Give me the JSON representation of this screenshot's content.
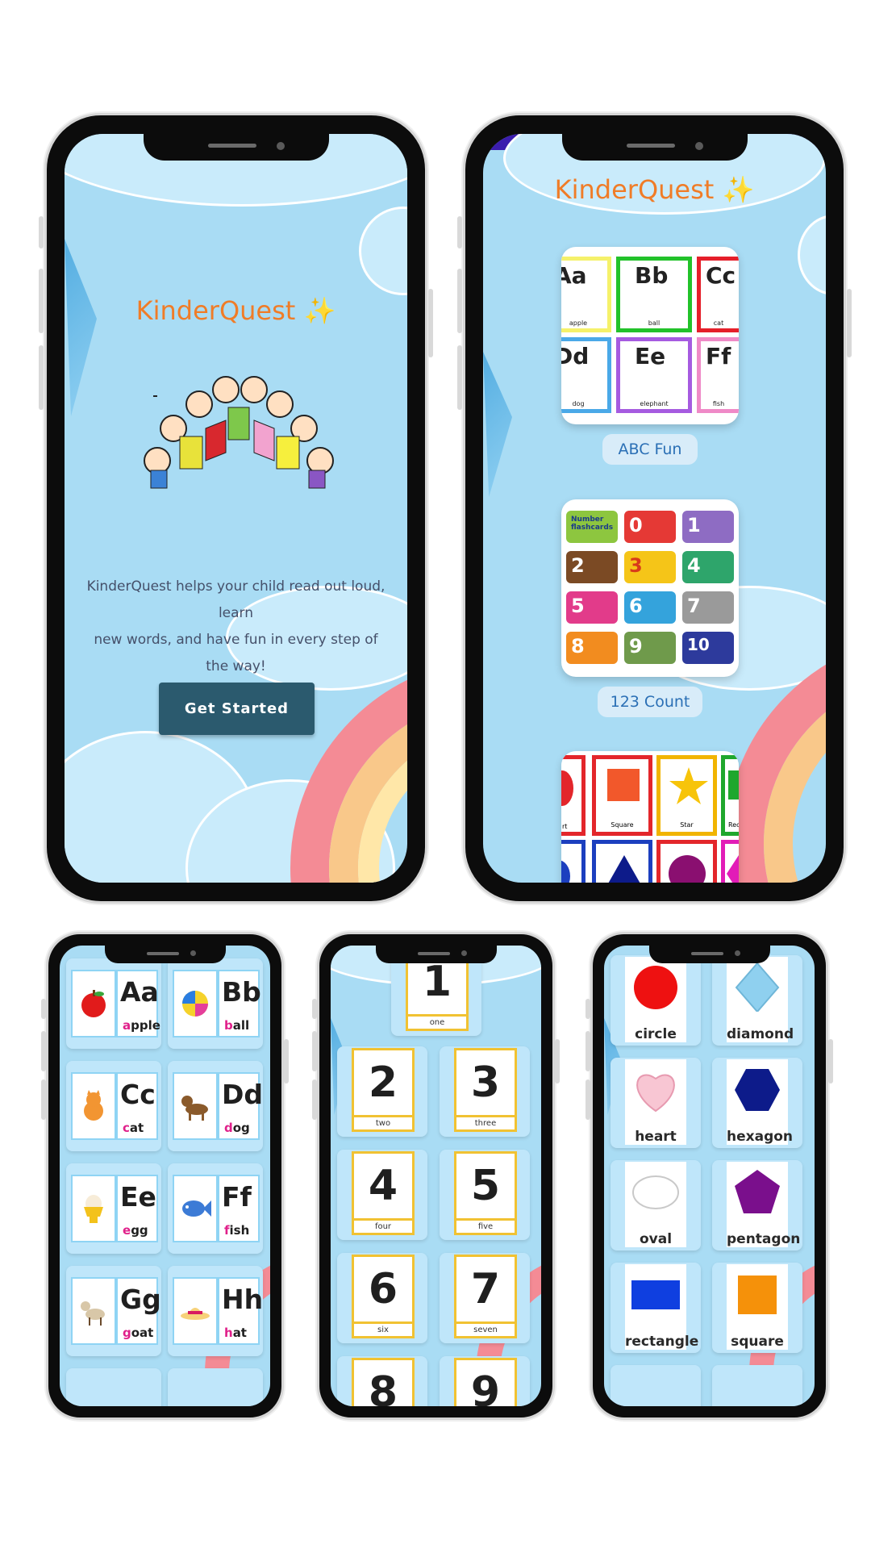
{
  "app": {
    "name": "KinderQuest",
    "sparkle": "✨"
  },
  "welcome": {
    "description_line1": "KinderQuest helps your child read out loud, learn",
    "description_line2": "new words, and have fun in every step of the way!",
    "button_label": "Get Started"
  },
  "menu": {
    "categories": [
      {
        "label": "ABC Fun"
      },
      {
        "label": "123 Count"
      }
    ],
    "abc_preview": [
      {
        "letters": "Aa",
        "word": "apple",
        "color": "#f5f16a"
      },
      {
        "letters": "Bb",
        "word": "ball",
        "color": "#22c22a"
      },
      {
        "letters": "Cc",
        "word": "cat",
        "color": "#e51f2a"
      },
      {
        "letters": "Dd",
        "word": "dog",
        "color": "#4aa9e8"
      },
      {
        "letters": "Ee",
        "word": "elephant",
        "color": "#a65be0"
      },
      {
        "letters": "Ff",
        "word": "fish",
        "color": "#ef8ac7"
      }
    ],
    "number_preview": [
      {
        "label": "Number flashcards",
        "color": "#8dc63f"
      },
      {
        "label": "0",
        "color": "#e53935"
      },
      {
        "label": "1",
        "color": "#8e6cc3"
      },
      {
        "label": "2",
        "color": "#7b4a24"
      },
      {
        "label": "3",
        "color": "#f5c518"
      },
      {
        "label": "4",
        "color": "#2ea56b"
      },
      {
        "label": "5",
        "color": "#e23b8a"
      },
      {
        "label": "6",
        "color": "#34a3dc"
      },
      {
        "label": "7",
        "color": "#9a9a9a"
      },
      {
        "label": "8",
        "color": "#f28c1f"
      },
      {
        "label": "9",
        "color": "#6f9a4b"
      },
      {
        "label": "10",
        "color": "#2d3a9c"
      }
    ],
    "shapes_preview": [
      {
        "word": "rt"
      },
      {
        "word": "Square"
      },
      {
        "word": "Star"
      },
      {
        "word": "Rect"
      }
    ]
  },
  "alphabet": [
    {
      "letters": "Aa",
      "prefix": "a",
      "rest": "pple",
      "icon": "apple-icon"
    },
    {
      "letters": "Bb",
      "prefix": "b",
      "rest": "all",
      "icon": "ball-icon"
    },
    {
      "letters": "Cc",
      "prefix": "c",
      "rest": "at",
      "icon": "cat-icon"
    },
    {
      "letters": "Dd",
      "prefix": "d",
      "rest": "og",
      "icon": "dog-icon"
    },
    {
      "letters": "Ee",
      "prefix": "e",
      "rest": "gg",
      "icon": "egg-icon"
    },
    {
      "letters": "Ff",
      "prefix": "f",
      "rest": "ish",
      "icon": "fish-icon"
    },
    {
      "letters": "Gg",
      "prefix": "g",
      "rest": "oat",
      "icon": "goat-icon"
    },
    {
      "letters": "Hh",
      "prefix": "h",
      "rest": "at",
      "icon": "hat-icon"
    }
  ],
  "numbers": [
    {
      "n": "1",
      "word": "one"
    },
    {
      "n": "2",
      "word": "two"
    },
    {
      "n": "3",
      "word": "three"
    },
    {
      "n": "4",
      "word": "four"
    },
    {
      "n": "5",
      "word": "five"
    },
    {
      "n": "6",
      "word": "six"
    },
    {
      "n": "7",
      "word": "seven"
    },
    {
      "n": "8",
      "word": ""
    },
    {
      "n": "9",
      "word": ""
    }
  ],
  "shapes": [
    {
      "word": "circle",
      "color": "#ee1111",
      "icon": "circle-icon"
    },
    {
      "word": "diamond",
      "color": "#8fd0ef",
      "icon": "diamond-icon"
    },
    {
      "word": "heart",
      "color": "#f8c6d3",
      "icon": "heart-icon"
    },
    {
      "word": "hexagon",
      "color": "#0d1b8a",
      "icon": "hexagon-icon"
    },
    {
      "word": "oval",
      "color": "#ffffff",
      "icon": "oval-icon"
    },
    {
      "word": "pentagon",
      "color": "#7a0f8c",
      "icon": "pentagon-icon"
    },
    {
      "word": "rectangle",
      "color": "#0f3fe0",
      "icon": "rectangle-icon"
    },
    {
      "word": "square",
      "color": "#f5910a",
      "icon": "square-icon"
    }
  ],
  "colors": {
    "sky": "#a9dcf4",
    "accent_orange": "#f07c27",
    "button": "#2b5a6e"
  }
}
